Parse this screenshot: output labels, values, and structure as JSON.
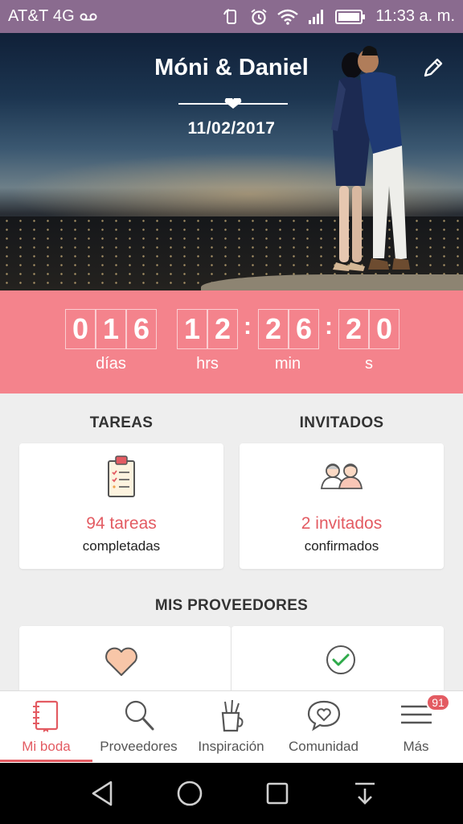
{
  "status_bar": {
    "carrier": "AT&T 4G",
    "time": "11:33 a. m."
  },
  "hero": {
    "couple_names": "Móni & Daniel",
    "wedding_date": "11/02/2017"
  },
  "countdown": {
    "days_digits": [
      "0",
      "1",
      "6"
    ],
    "hours_digits": [
      "1",
      "2"
    ],
    "minutes_digits": [
      "2",
      "6"
    ],
    "seconds_digits": [
      "2",
      "0"
    ],
    "labels": {
      "days": "días",
      "hours": "hrs",
      "minutes": "min",
      "seconds": "s"
    }
  },
  "tasks": {
    "title": "TAREAS",
    "value": "94 tareas",
    "sub": "completadas",
    "icon": "clipboard-icon"
  },
  "guests": {
    "title": "INVITADOS",
    "value": "2 invitados",
    "sub": "confirmados",
    "icon": "guests-icon"
  },
  "providers": {
    "title": "MIS PROVEEDORES",
    "icons": [
      "heart-icon",
      "check-circle-icon"
    ]
  },
  "bottom_nav": {
    "items": [
      {
        "label": "Mi boda",
        "icon": "notebook-icon"
      },
      {
        "label": "Proveedores",
        "icon": "search-icon"
      },
      {
        "label": "Inspiración",
        "icon": "brushes-icon"
      },
      {
        "label": "Comunidad",
        "icon": "chat-heart-icon"
      },
      {
        "label": "Más",
        "icon": "menu-icon"
      }
    ],
    "badge": "91"
  },
  "colors": {
    "accent": "#e35b62",
    "countdown_bg": "#f4838c",
    "status_bar": "#8a6b8f"
  }
}
